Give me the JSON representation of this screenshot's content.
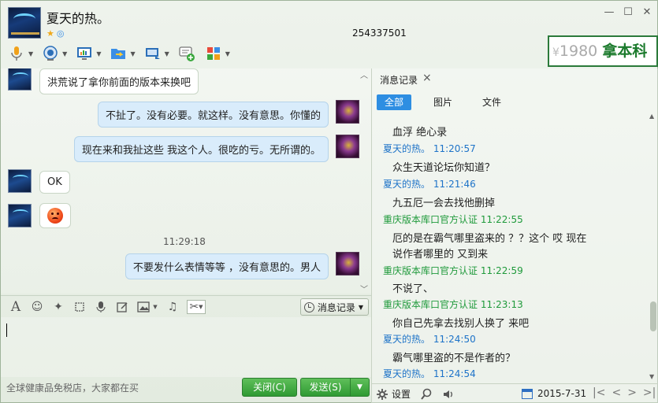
{
  "window": {
    "title": "夏天的热。",
    "qq_number": "254337501",
    "controls": [
      "minimize",
      "maximize",
      "close"
    ]
  },
  "ad_banner": {
    "currency": "¥",
    "number": "1980",
    "text": "拿本科"
  },
  "toolbar": {
    "items": [
      {
        "icon": "microphone-icon"
      },
      {
        "icon": "webcam-icon"
      },
      {
        "icon": "remote-desktop-icon"
      },
      {
        "icon": "send-file-icon"
      },
      {
        "icon": "screen-share-icon"
      },
      {
        "icon": "create-discussion-icon"
      },
      {
        "icon": "apps-icon"
      }
    ]
  },
  "chat": {
    "messages": [
      {
        "side": "left",
        "type": "text",
        "text": "洪荒说了拿你前面的版本来换吧"
      },
      {
        "side": "right",
        "type": "text",
        "text": "不扯了。没有必要。就这样。没有意思。你懂的"
      },
      {
        "side": "right",
        "type": "text",
        "text": "现在来和我扯这些  我这个人。很吃的亏。无所谓的。"
      },
      {
        "side": "left",
        "type": "text",
        "text": "OK"
      },
      {
        "side": "left",
        "type": "emoji",
        "text": "angry-emoji"
      },
      {
        "side": "right",
        "type": "text",
        "text": "不要发什么表情等等 ，没有意思的。男人"
      }
    ],
    "time_separator": "11:29:18"
  },
  "input_toolbar": {
    "icons": [
      "font-icon",
      "emoticon-icon",
      "shake-icon",
      "screenshot-icon",
      "voice-message-icon",
      "whiteboard-icon",
      "image-icon",
      "music-icon",
      "scissors-icon"
    ],
    "history_button": "消息记录"
  },
  "footer": {
    "tip": "全球健康品免税店，大家都在买",
    "close_button": "关闭(C)",
    "send_button": "发送(S)"
  },
  "history_panel": {
    "tab_label": "消息记录",
    "filters": [
      {
        "label": "全部",
        "active": true
      },
      {
        "label": "图片",
        "active": false
      },
      {
        "label": "文件",
        "active": false
      }
    ],
    "entries": [
      {
        "text": "血浮  绝心录",
        "sender": "夏天的热。",
        "time": "11:20:57",
        "sender_color": "blue"
      },
      {
        "text": "众生天道论坛你知道？",
        "sender": "夏天的热。",
        "time": "11:21:46",
        "sender_color": "blue"
      },
      {
        "text": "九五厄一会去找他删掉",
        "sender": "重庆版本库口官方认证",
        "time": "11:22:55",
        "sender_color": "green"
      },
      {
        "text": "厄的是在霸气哪里盗来的  ？？这个 哎 现在",
        "text2": "说作者哪里的 又到来",
        "sender": "重庆版本库口官方认证",
        "time": "11:22:59",
        "sender_color": "green"
      },
      {
        "text": "不说了、",
        "sender": "重庆版本库口官方认证",
        "time": "11:23:13",
        "sender_color": "green"
      },
      {
        "text": "你自己先拿去找别人换了 来吧",
        "sender": "夏天的热。",
        "time": "11:24:50",
        "sender_color": "blue"
      },
      {
        "text": "霸气哪里盗的不是作者的？",
        "sender": "夏天的热。",
        "time": "11:24:54",
        "sender_color": "blue"
      }
    ],
    "settings_label": "设置",
    "date": "2015-7-31"
  },
  "colors": {
    "accent_blue": "#2e8ee2",
    "sender_blue": "#1e73c8",
    "sender_green": "#1f9a3b",
    "button_green": "#3aa83d"
  }
}
